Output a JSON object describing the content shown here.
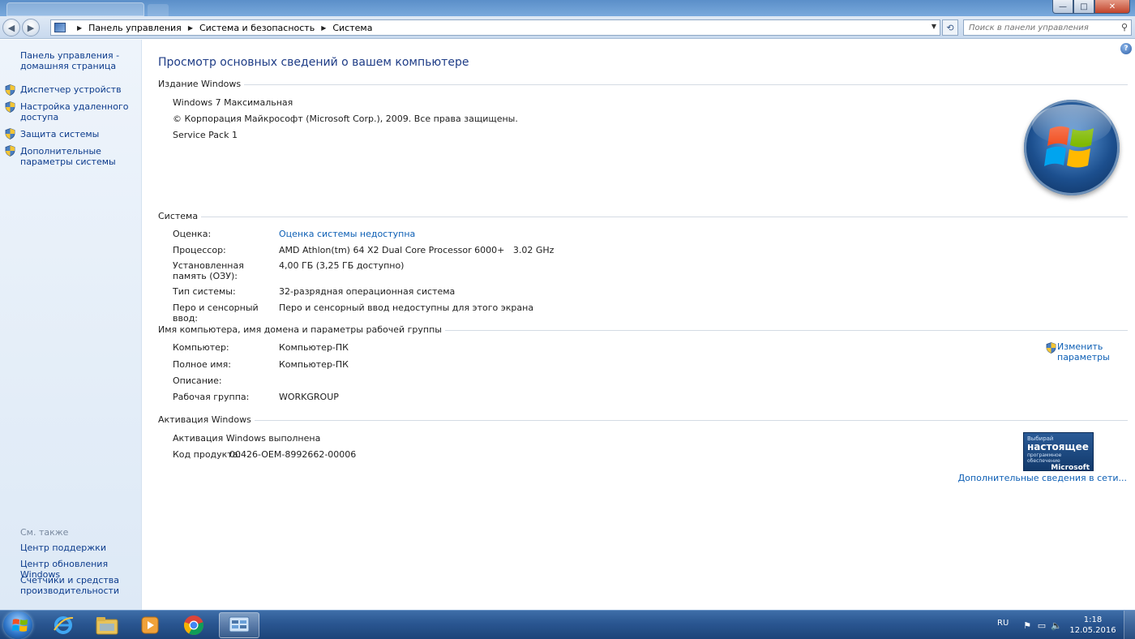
{
  "window": {
    "buttons": {
      "minimize": "—",
      "maximize": "□",
      "close": "✕"
    }
  },
  "address": {
    "crumbs": [
      "Панель управления",
      "Система и безопасность",
      "Система"
    ],
    "search_placeholder": "Поиск в панели управления"
  },
  "sidebar": {
    "home": "Панель управления - домашняя страница",
    "items": [
      {
        "label": "Диспетчер устройств"
      },
      {
        "label": "Настройка удаленного доступа"
      },
      {
        "label": "Защита системы"
      },
      {
        "label": "Дополнительные параметры системы"
      }
    ],
    "see_also": {
      "title": "См. также",
      "items": [
        {
          "label": "Центр поддержки"
        },
        {
          "label": "Центр обновления Windows"
        },
        {
          "label": "Счетчики и средства производительности"
        }
      ]
    }
  },
  "main": {
    "title": "Просмотр основных сведений о вашем компьютере",
    "edition": {
      "title": "Издание Windows",
      "name": "Windows 7 Максимальная",
      "copyright": "© Корпорация Майкрософт (Microsoft Corp.), 2009. Все права защищены.",
      "service_pack": "Service Pack 1"
    },
    "system": {
      "title": "Система",
      "rating_label": "Оценка:",
      "rating_value": "Оценка системы недоступна",
      "cpu_label": "Процессор:",
      "cpu_value": "AMD Athlon(tm) 64 X2 Dual Core Processor 6000+   3.02 GHz",
      "ram_label": "Установленная память (ОЗУ):",
      "ram_value": "4,00 ГБ (3,25 ГБ доступно)",
      "type_label": "Тип системы:",
      "type_value": "32-разрядная операционная система",
      "pen_label": "Перо и сенсорный ввод:",
      "pen_value": "Перо и сенсорный ввод недоступны для этого экрана"
    },
    "computer": {
      "title": "Имя компьютера, имя домена и параметры рабочей группы",
      "name_label": "Компьютер:",
      "name_value": "Компьютер-ПК",
      "fullname_label": "Полное имя:",
      "fullname_value": "Компьютер-ПК",
      "desc_label": "Описание:",
      "desc_value": "",
      "workgroup_label": "Рабочая группа:",
      "workgroup_value": "WORKGROUP",
      "change_link": "Изменить параметры"
    },
    "activation": {
      "title": "Активация Windows",
      "status": "Активация Windows выполнена",
      "product_key_label": "Код продукта:",
      "product_key_value": "00426-OEM-8992662-00006",
      "badge": {
        "line1": "Выбирай",
        "line2": "настоящее",
        "line3": "программное обеспечение",
        "line4": "Microsoft"
      },
      "more_info": "Дополнительные сведения в сети..."
    }
  },
  "taskbar": {
    "language": "RU",
    "time": "1:18",
    "date": "12.05.2016"
  },
  "colors": {
    "link": "#0d5fb5",
    "title": "#1e3c86",
    "sidebar_bg": "#e6eef8",
    "taskbar": "#2a5691"
  }
}
